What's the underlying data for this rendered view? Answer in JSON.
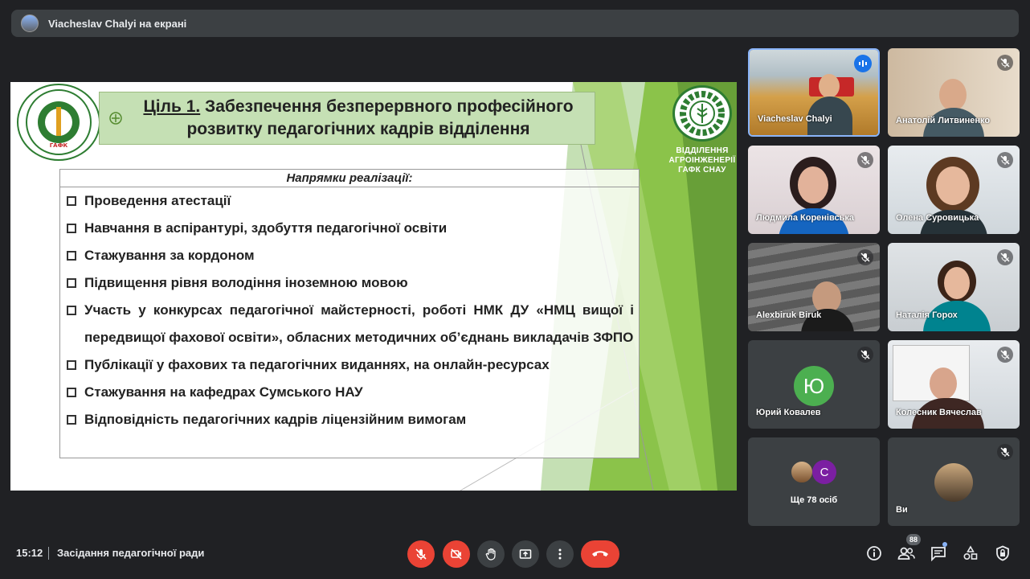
{
  "presenter_bar": {
    "text": "Viacheslav Chalyi на екрані"
  },
  "slide": {
    "title_underlined": "Ціль 1.",
    "title_rest": " Забезпечення безперервного професійного розвитку педагогічних кадрів відділення",
    "list_header": "Напрямки реалізації:",
    "items": [
      "Проведення атестації",
      "Навчання в аспірантурі, здобуття педагогічної освіти",
      "Стажування за кордоном",
      "Підвищення рівня володіння іноземною мовою",
      "Участь у конкурсах педагогічної майстерності, роботі НМК ДУ «НМЦ вищої і передвищої фахової освіти», обласних методичних об’єднань викладачів ЗФПО",
      "Публікації у фахових та педагогічних виданнях, на онлайн-ресурсах",
      "Стажування на кафедрах Сумського НАУ",
      "Відповідність педагогічних кадрів ліцензійним вимогам"
    ],
    "dept_line1": "ВІДДІЛЕННЯ",
    "dept_line2": "АГРОІНЖЕНЕРІЇ",
    "dept_line3": "ГАФК СНАУ",
    "logo_year": "1899",
    "logo_abbr": "ГАФК"
  },
  "participants": [
    {
      "name": "Viacheslav Chalyi",
      "speaking": true
    },
    {
      "name": "Анатолій Литвиненко",
      "muted": true
    },
    {
      "name": "Людмила Коренівська",
      "muted": true
    },
    {
      "name": "Олена Суровицька",
      "muted": true
    },
    {
      "name": "Alexbiruk Biruk",
      "muted": true
    },
    {
      "name": "Наталія Горох",
      "muted": true
    },
    {
      "name": "Юрий Ковалев",
      "initial": "Ю",
      "muted": true
    },
    {
      "name": "Колесник Вячеслав",
      "muted": true
    },
    {
      "name": "Ще 78 осіб",
      "initial": "C"
    },
    {
      "name": "Ви",
      "muted": true
    }
  ],
  "bottom": {
    "time": "15:12",
    "meeting_title": "Засідання педагогічної ради",
    "people_count": "88"
  },
  "colors": {
    "background": "#202124",
    "danger": "#ea4335",
    "slide_green": "#8bc34a",
    "title_green": "#c5e0b4"
  }
}
